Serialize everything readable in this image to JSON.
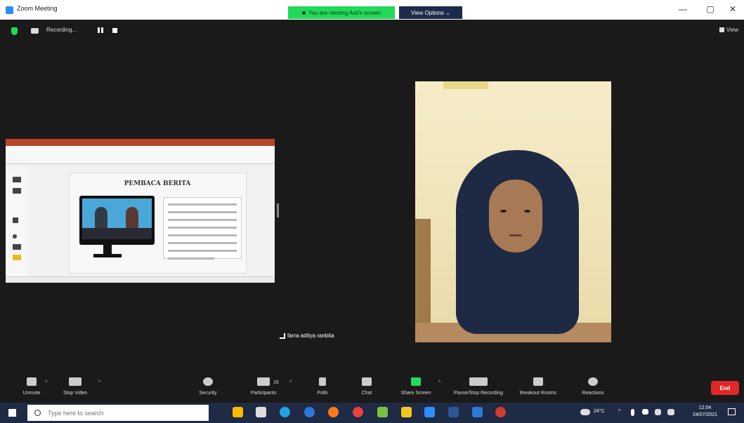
{
  "window": {
    "title": "Zoom Meeting",
    "share_banner": "You are viewing Asti's screen",
    "view_options": "View Options",
    "controls": {
      "minimize": "—",
      "maximize": "▢",
      "close": "✕"
    }
  },
  "meeting_bar": {
    "recording_label": "Recording...",
    "view_label": "View"
  },
  "shared_screen": {
    "slide_title": "PEMBACA BERITA"
  },
  "participant": {
    "name": "farra aditya ranbita"
  },
  "toolbar": {
    "items": [
      {
        "label": "Unmute",
        "icon": "mic-muted-icon"
      },
      {
        "label": "Stop Video",
        "icon": "video-camera-icon"
      },
      {
        "label": "Security",
        "icon": "shield-icon"
      },
      {
        "label": "Participants",
        "icon": "participants-icon",
        "count": "16"
      },
      {
        "label": "Polls",
        "icon": "polls-icon"
      },
      {
        "label": "Chat",
        "icon": "chat-icon"
      },
      {
        "label": "Share Screen",
        "icon": "share-screen-icon"
      },
      {
        "label": "Pause/Stop Recording",
        "icon": "pause-recording-icon"
      },
      {
        "label": "Breakout Rooms",
        "icon": "breakout-rooms-icon"
      },
      {
        "label": "Reactions",
        "icon": "reactions-icon"
      }
    ],
    "end_label": "End",
    "accent": "#23d959",
    "end_color": "#e02828"
  },
  "taskbar": {
    "search_placeholder": "Type here to search",
    "temperature": "24°C",
    "time": "12:04",
    "date": "24/07/2021"
  }
}
